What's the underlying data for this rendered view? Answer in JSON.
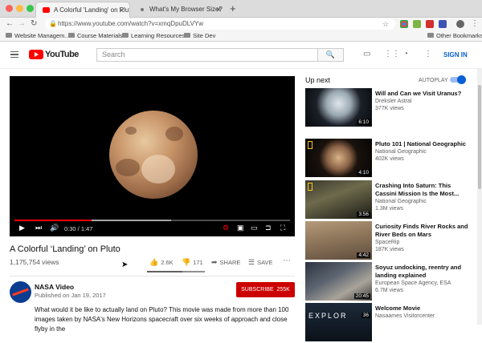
{
  "browser": {
    "tabs": [
      {
        "title": "A Colorful 'Landing' on Pluto",
        "active": true
      },
      {
        "title": "What's My Browser Size?",
        "active": false
      }
    ],
    "url": "https://www.youtube.com/watch?v=xmqDpuDLVYw",
    "bookmarks": [
      "Website Managem...",
      "Course Materials",
      "Learning Resources",
      "Site Dev"
    ],
    "other_bookmarks": "Other Bookmarks"
  },
  "youtube": {
    "logo_text": "YouTube",
    "search_placeholder": "Search",
    "sign_in": "SIGN IN"
  },
  "player": {
    "time": "0:30 / 1:47",
    "progress": 0.28
  },
  "video": {
    "title": "A Colorful ‘Landing’ on Pluto",
    "views": "1,175,754 views",
    "likes": "2.6K",
    "dislikes": "171",
    "share": "SHARE",
    "save": "SAVE",
    "channel": "NASA Video",
    "published": "Published on Jan 19, 2017",
    "subscribe": "SUBSCRIBE",
    "subscribers": "255K",
    "description": "What would it be like to actually land on Pluto? This movie was made from more than 100 images taken by NASA's New Horizons spacecraft over six weeks of approach and close flyby in the"
  },
  "sidebar": {
    "up_next": "Up next",
    "autoplay": "AUTOPLAY",
    "items": [
      {
        "title": "Will and Can we Visit Uranus?",
        "channel": "Dreksler Astral",
        "views": "377K views",
        "duration": "6:10"
      },
      {
        "title": "Pluto 101 | National Geographic",
        "channel": "National Geographic",
        "views": "402K views",
        "duration": "4:10"
      },
      {
        "title": "Crashing Into Saturn: This Cassini Mission Is the Most...",
        "channel": "National Geographic",
        "views": "1.3M views",
        "duration": "3:56"
      },
      {
        "title": "Curiosity Finds River Rocks and River Beds on Mars",
        "channel": "SpaceRip",
        "views": "187K views",
        "duration": "4:42"
      },
      {
        "title": "Soyuz undocking, reentry and landing explained",
        "channel": "European Space Agency, ESA",
        "views": "6.7M views",
        "duration": "20:45"
      },
      {
        "title": "Welcome Movie",
        "channel": "Nasaames Visitorcenter",
        "views": "",
        "duration": "36",
        "thumb_text": "EXPLOR"
      }
    ]
  },
  "colors": {
    "youtube_red": "#ff0000",
    "link_blue": "#065fd4",
    "subscribe_red": "#cc0000"
  }
}
